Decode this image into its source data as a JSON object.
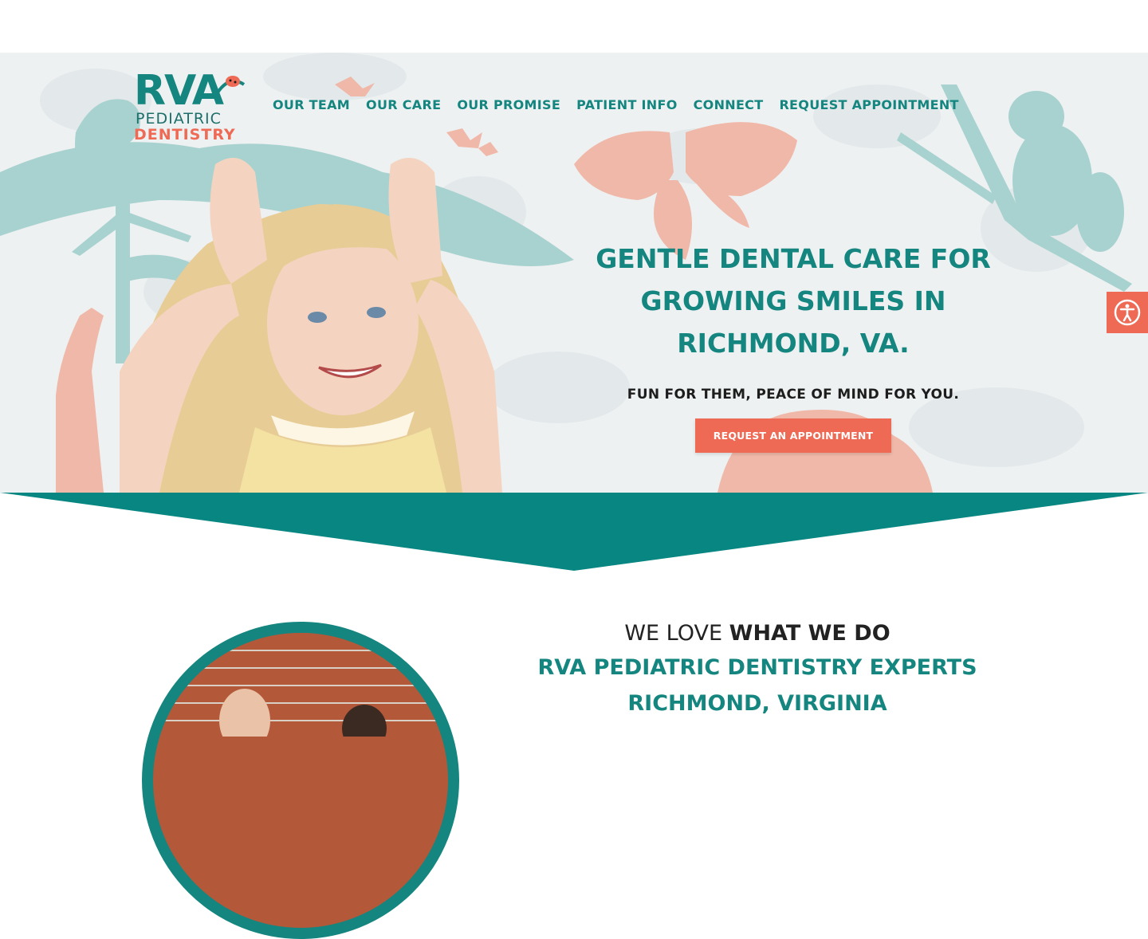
{
  "logo": {
    "line1": "RVA",
    "line2": "PEDIATRIC",
    "line3": "DENTISTRY"
  },
  "nav": [
    "OUR TEAM",
    "OUR CARE",
    "OUR PROMISE",
    "PATIENT INFO",
    "CONNECT",
    "REQUEST APPOINTMENT"
  ],
  "hero": {
    "title": "GENTLE DENTAL CARE FOR\nGROWING SMILES IN\nRICHMOND, VA.",
    "subtitle": "FUN FOR THEM, PEACE OF MIND FOR YOU.",
    "cta": "REQUEST AN APPOINTMENT"
  },
  "about": {
    "line1_light": "WE LOVE ",
    "line1_bold": "WHAT WE DO",
    "line2": "RVA PEDIATRIC DENTISTRY EXPERTS",
    "line3": "RICHMOND, VIRGINIA"
  },
  "colors": {
    "teal": "#14857f",
    "coral": "#ee6a55",
    "dark": "#1d1d1d"
  },
  "icons": [
    "accessibility-icon",
    "ladybug-icon"
  ]
}
